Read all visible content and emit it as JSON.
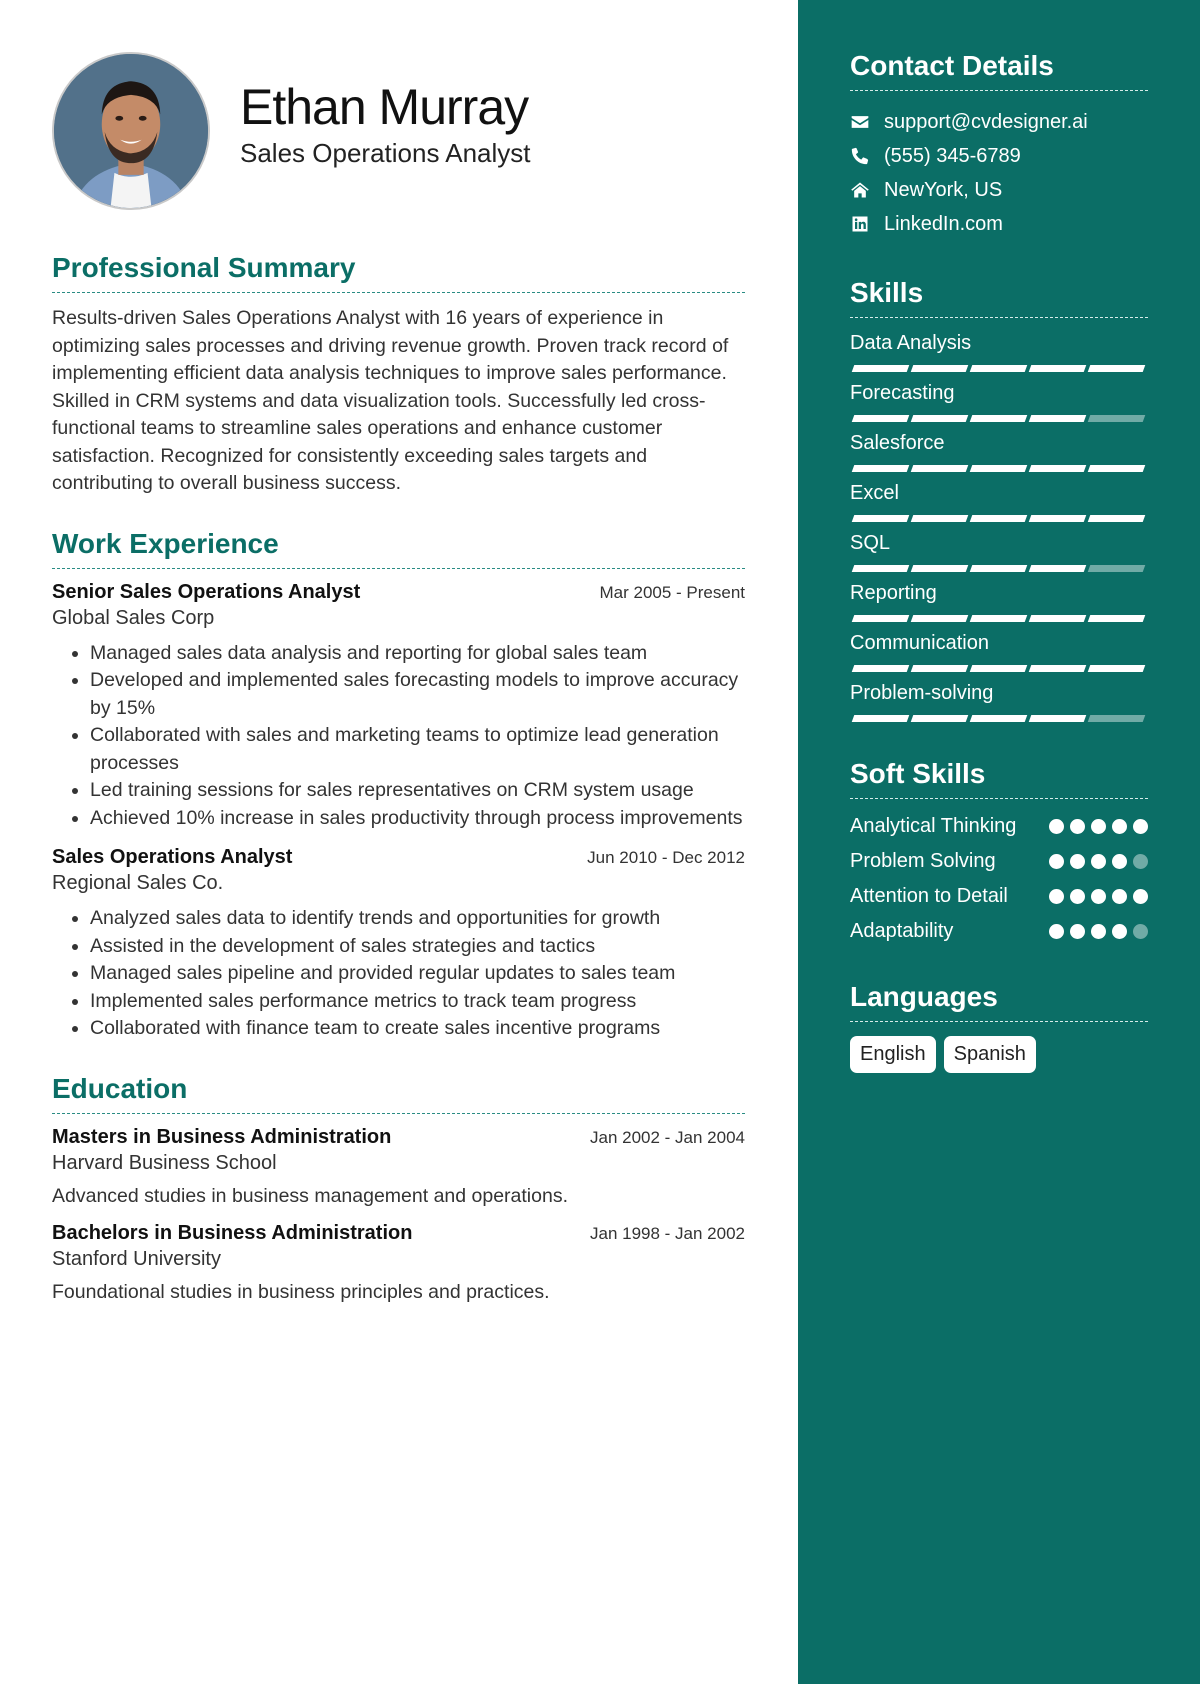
{
  "header": {
    "name": "Ethan Murray",
    "title": "Sales Operations Analyst"
  },
  "summary": {
    "heading": "Professional Summary",
    "text": "Results-driven Sales Operations Analyst with 16 years of experience in optimizing sales processes and driving revenue growth. Proven track record of implementing efficient data analysis techniques to improve sales performance. Skilled in CRM systems and data visualization tools. Successfully led cross-functional teams to streamline sales operations and enhance customer satisfaction. Recognized for consistently exceeding sales targets and contributing to overall business success."
  },
  "experience": {
    "heading": "Work Experience",
    "jobs": [
      {
        "title": "Senior Sales Operations Analyst",
        "date": "Mar 2005 - Present",
        "company": "Global Sales Corp",
        "bullets": [
          "Managed sales data analysis and reporting for global sales team",
          "Developed and implemented sales forecasting models to improve accuracy by 15%",
          "Collaborated with sales and marketing teams to optimize lead generation processes",
          "Led training sessions for sales representatives on CRM system usage",
          "Achieved 10% increase in sales productivity through process improvements"
        ]
      },
      {
        "title": "Sales Operations Analyst",
        "date": "Jun 2010 - Dec 2012",
        "company": "Regional Sales Co.",
        "bullets": [
          "Analyzed sales data to identify trends and opportunities for growth",
          "Assisted in the development of sales strategies and tactics",
          "Managed sales pipeline and provided regular updates to sales team",
          "Implemented sales performance metrics to track team progress",
          "Collaborated with finance team to create sales incentive programs"
        ]
      }
    ]
  },
  "education": {
    "heading": "Education",
    "items": [
      {
        "degree": "Masters in Business Administration",
        "date": "Jan 2002 - Jan 2004",
        "school": "Harvard Business School",
        "description": "Advanced studies in business management and operations."
      },
      {
        "degree": "Bachelors in Business Administration",
        "date": "Jan 1998 - Jan 2002",
        "school": "Stanford University",
        "description": "Foundational studies in business principles and practices."
      }
    ]
  },
  "contact": {
    "heading": "Contact Details",
    "items": [
      {
        "icon": "envelope-icon",
        "text": "support@cvdesigner.ai"
      },
      {
        "icon": "phone-icon",
        "text": "(555) 345-6789"
      },
      {
        "icon": "home-icon",
        "text": "NewYork, US"
      },
      {
        "icon": "linkedin-icon",
        "text": "LinkedIn.com"
      }
    ]
  },
  "skills": {
    "heading": "Skills",
    "max": 5,
    "items": [
      {
        "name": "Data Analysis",
        "level": 5
      },
      {
        "name": "Forecasting",
        "level": 4
      },
      {
        "name": "Salesforce",
        "level": 5
      },
      {
        "name": "Excel",
        "level": 5
      },
      {
        "name": "SQL",
        "level": 4
      },
      {
        "name": "Reporting",
        "level": 5
      },
      {
        "name": "Communication",
        "level": 5
      },
      {
        "name": "Problem-solving",
        "level": 4
      }
    ]
  },
  "soft_skills": {
    "heading": "Soft Skills",
    "max": 5,
    "items": [
      {
        "name": "Analytical Thinking",
        "level": 5
      },
      {
        "name": "Problem Solving",
        "level": 4
      },
      {
        "name": "Attention to Detail",
        "level": 5
      },
      {
        "name": "Adaptability",
        "level": 4
      }
    ]
  },
  "languages": {
    "heading": "Languages",
    "items": [
      "English",
      "Spanish"
    ]
  },
  "colors": {
    "accent": "#0b6e66",
    "sidebar_bg": "#0b6e66"
  }
}
